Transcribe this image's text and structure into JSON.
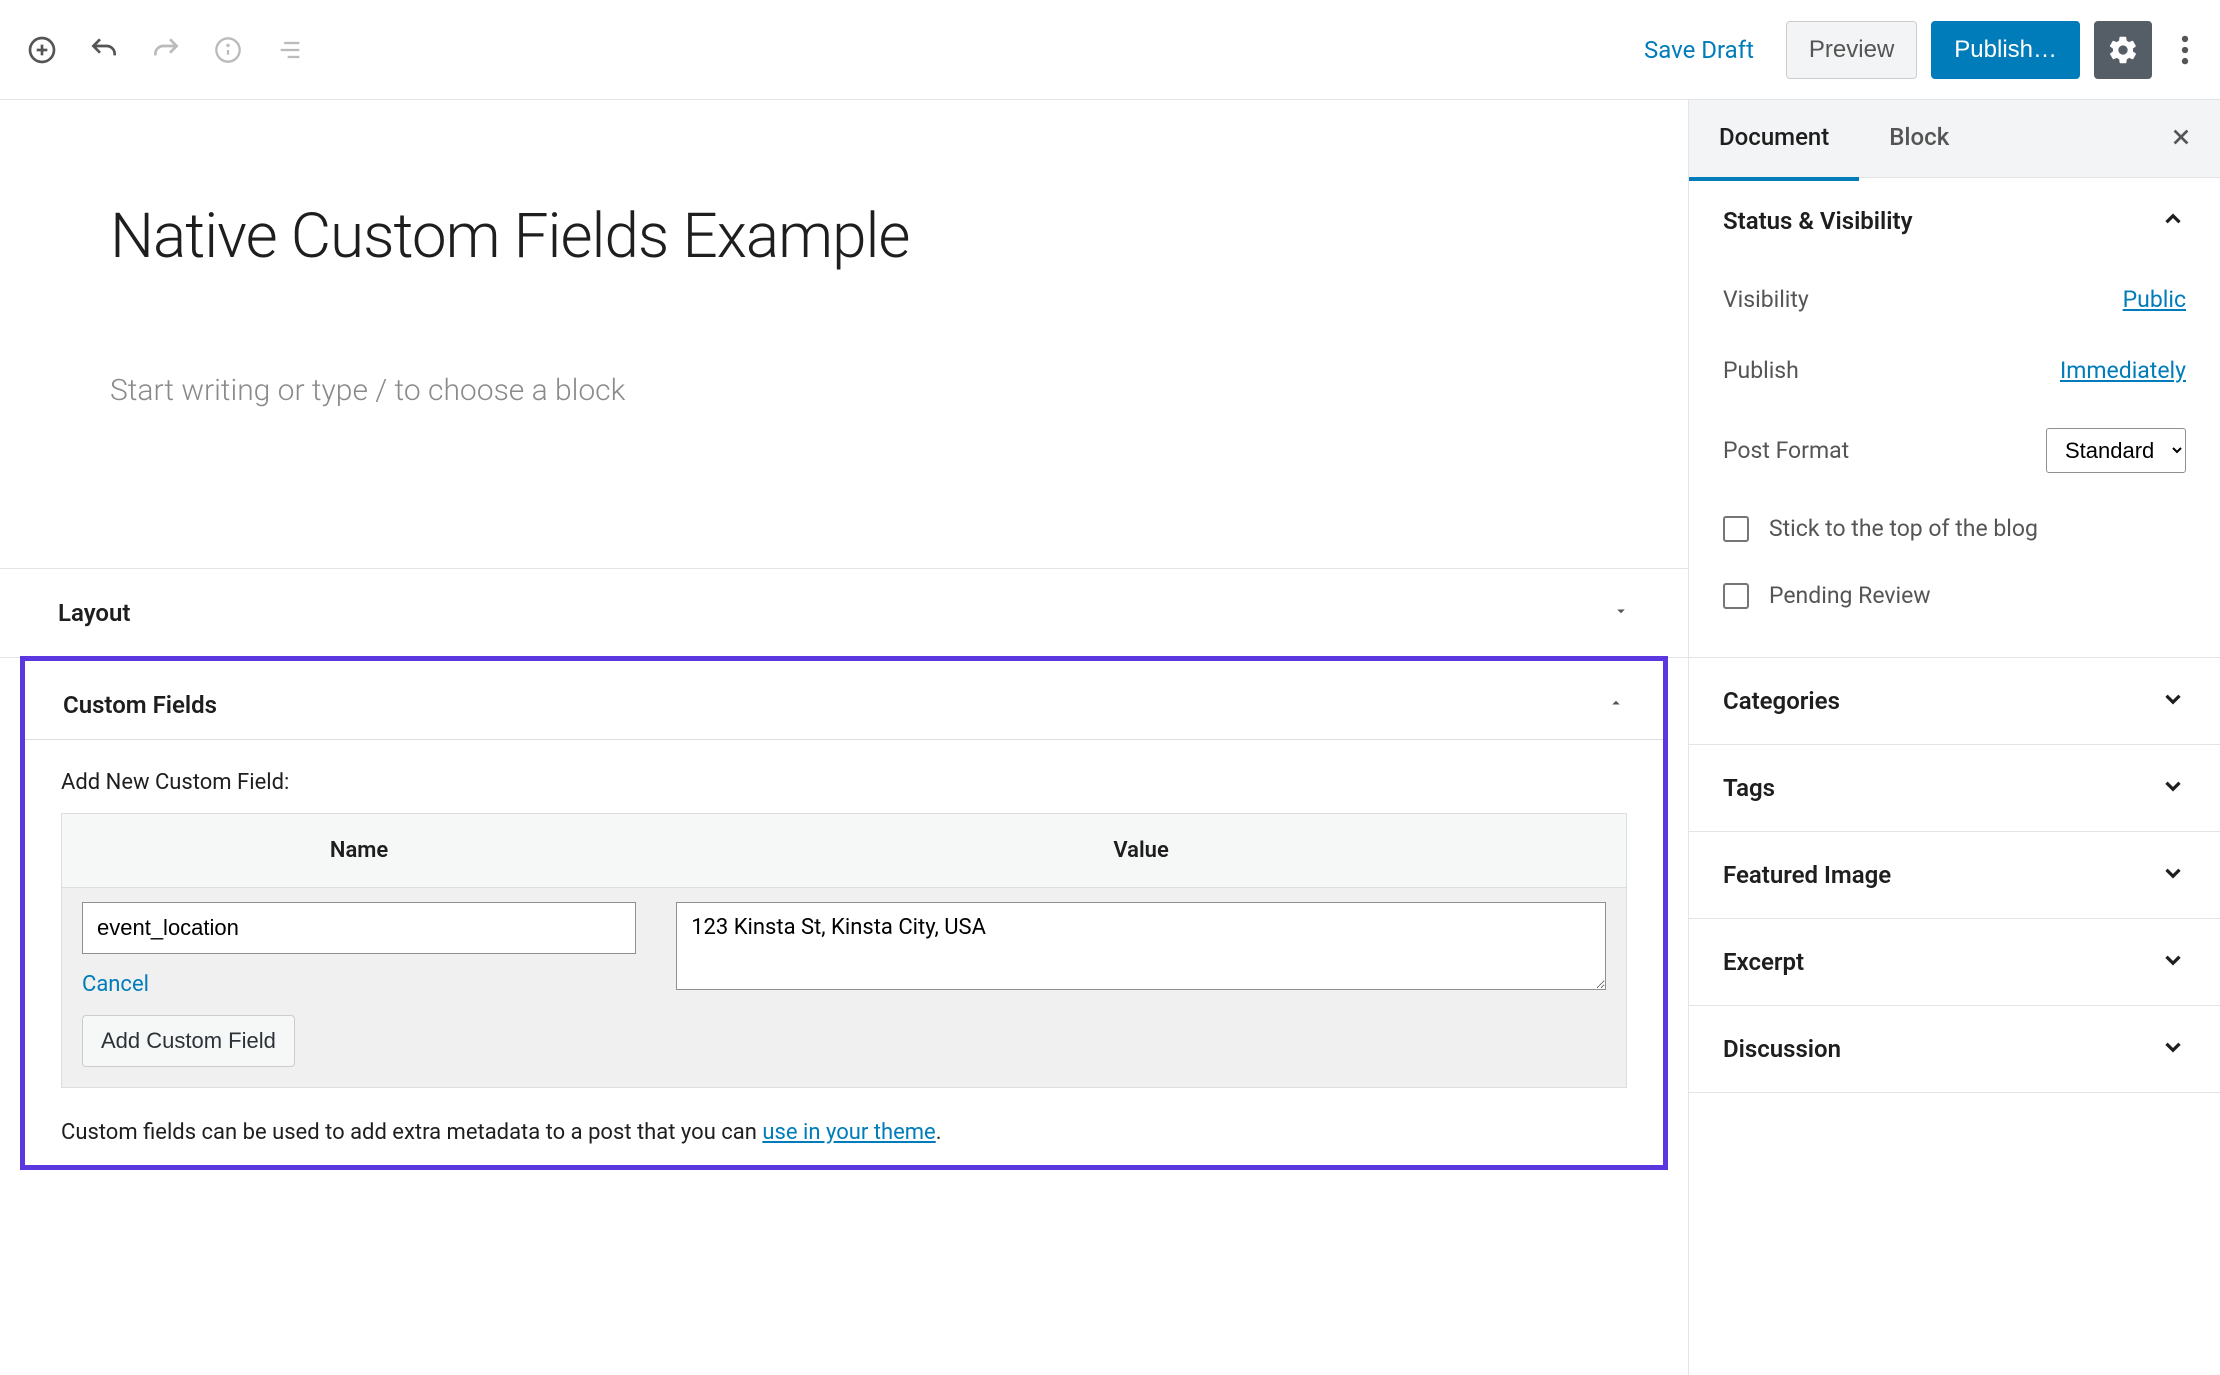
{
  "toolbar": {
    "save_draft": "Save Draft",
    "preview": "Preview",
    "publish": "Publish…"
  },
  "post": {
    "title": "Native Custom Fields Example",
    "block_placeholder": "Start writing or type / to choose a block"
  },
  "metaboxes": {
    "layout_title": "Layout",
    "custom_fields": {
      "title": "Custom Fields",
      "add_label": "Add New Custom Field:",
      "name_header": "Name",
      "value_header": "Value",
      "name_value": "event_location",
      "value_value": "123 Kinsta St, Kinsta City, USA",
      "cancel": "Cancel",
      "add_button": "Add Custom Field",
      "hint_prefix": "Custom fields can be used to add extra metadata to a post that you can ",
      "hint_link": "use in your theme",
      "hint_suffix": "."
    }
  },
  "sidebar": {
    "tabs": {
      "document": "Document",
      "block": "Block"
    },
    "status": {
      "title": "Status & Visibility",
      "visibility_label": "Visibility",
      "visibility_value": "Public",
      "publish_label": "Publish",
      "publish_value": "Immediately",
      "post_format_label": "Post Format",
      "post_format_value": "Standard",
      "stick": "Stick to the top of the blog",
      "pending": "Pending Review"
    },
    "panels": {
      "categories": "Categories",
      "tags": "Tags",
      "featured_image": "Featured Image",
      "excerpt": "Excerpt",
      "discussion": "Discussion"
    }
  }
}
